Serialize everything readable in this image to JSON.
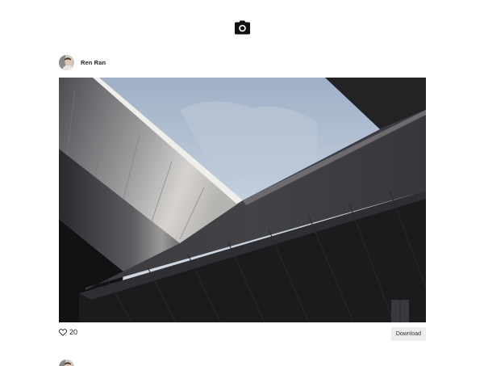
{
  "header": {
    "icon": "camera-icon"
  },
  "post": {
    "author": {
      "name": "Ren Ran",
      "avatar_icon": "avatar"
    },
    "photo": {
      "icon": "architecture-photo"
    },
    "likes": {
      "icon": "heart-icon",
      "count": "20"
    },
    "download_label": "Download"
  },
  "next_post": {
    "avatar_icon": "avatar"
  }
}
